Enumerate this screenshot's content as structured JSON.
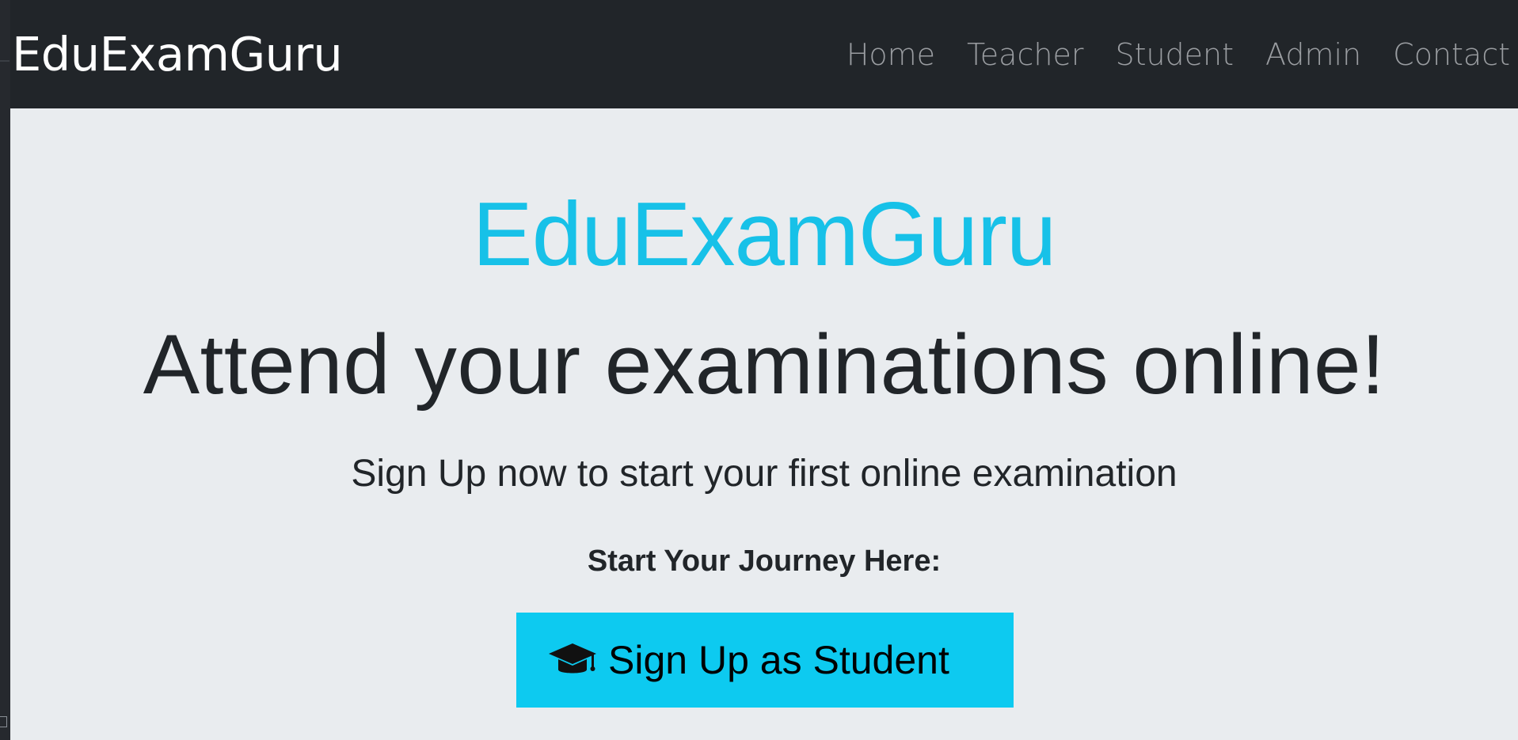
{
  "navbar": {
    "brand": "EduExamGuru",
    "links": [
      {
        "label": "Home"
      },
      {
        "label": "Teacher"
      },
      {
        "label": "Student"
      },
      {
        "label": "Admin"
      },
      {
        "label": "Contact"
      }
    ]
  },
  "hero": {
    "brand": "EduExamGuru",
    "headline": "Attend your examinations online!",
    "subline": "Sign Up now to start your first online examination",
    "journey_label": "Start Your Journey Here:",
    "signup_button": {
      "icon": "graduation-cap-icon",
      "label": "Sign Up as Student"
    }
  },
  "colors": {
    "navbar_bg": "#212529",
    "jumbotron_bg": "#e9ecef",
    "accent": "#17c1e8",
    "button_bg": "#0dcaf0"
  }
}
